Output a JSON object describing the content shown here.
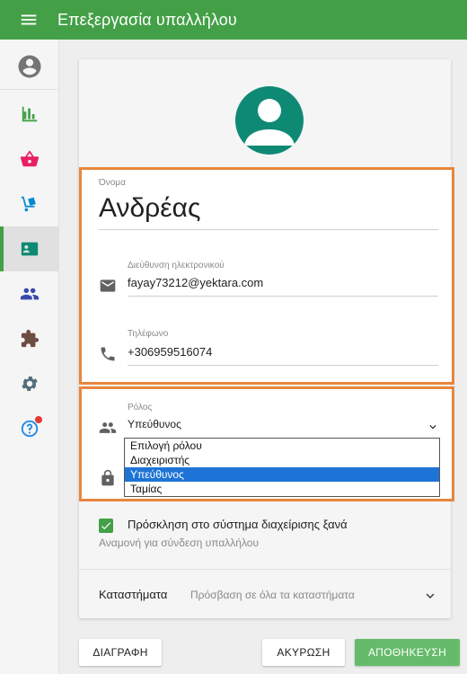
{
  "app": {
    "title": "Επεξεργασία υπαλλήλου"
  },
  "icons": {
    "menu": "menu-icon",
    "sidebar": [
      "account-circle-icon",
      "bar-chart-icon",
      "basket-icon",
      "hand-truck-icon",
      "contact-card-icon",
      "people-icon",
      "puzzle-icon",
      "gear-icon",
      "help-icon"
    ]
  },
  "colors": {
    "topbar": "#43a047",
    "avatar": "#0e8a74",
    "highlight": "#e8863d",
    "selected_option": "#1e74d6",
    "save_button": "#66bb6a"
  },
  "form": {
    "name": {
      "label": "Όνομα",
      "value": "Ανδρέας"
    },
    "email": {
      "label": "Διεύθυνση ηλεκτρονικού",
      "value": "fayay73212@yektara.com"
    },
    "phone": {
      "label": "Τηλέφωνο",
      "value": "+306959516074"
    },
    "role": {
      "label": "Ρόλος",
      "value": "Υπεύθυνος",
      "options": [
        "Επιλογή ρόλου",
        "Διαχειριστής",
        "Υπεύθυνος",
        "Ταμίας"
      ],
      "selected_index": 2
    },
    "invite": {
      "checked": true,
      "label": "Πρόσκληση στο σύστημα διαχείρισης ξανά",
      "sublabel": "Αναμονή για σύνδεση υπαλλήλου"
    },
    "stores": {
      "label": "Καταστήματα",
      "value": "Πρόσβαση σε όλα τα καταστήματα"
    }
  },
  "buttons": {
    "delete": "ΔΙΑΓΡΑΦΗ",
    "cancel": "ΑΚΥΡΩΣΗ",
    "save": "ΑΠΟΘΗΚΕΥΣΗ"
  }
}
